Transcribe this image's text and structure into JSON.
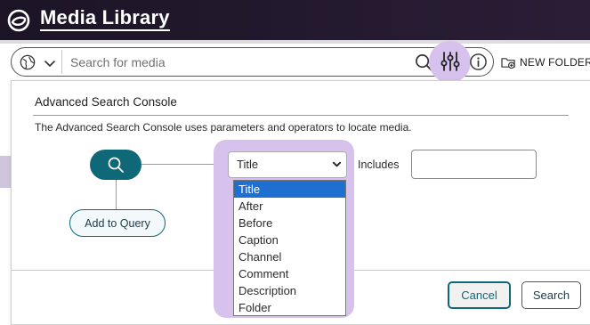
{
  "header": {
    "title": "Media Library"
  },
  "search": {
    "placeholder": "Search for media",
    "value": ""
  },
  "toolbar": {
    "new_folder_label": "NEW FOLDER"
  },
  "panel": {
    "title": "Advanced Search Console",
    "description": "The Advanced Search Console uses parameters and operators to locate media.",
    "add_to_query_label": "Add to Query",
    "operator_label": "Includes",
    "field_selected": "Title",
    "field_options": [
      "Title",
      "After",
      "Before",
      "Caption",
      "Channel",
      "Comment",
      "Description",
      "Folder"
    ],
    "value_input": "",
    "cancel_label": "Cancel",
    "search_label": "Search"
  },
  "colors": {
    "header_bg": "#1c1426",
    "accent_teal": "#0e6878",
    "highlight_lilac": "#d6c2ec",
    "selection_blue": "#1f6fd1"
  },
  "icons": [
    "logo-icon",
    "globe-icon",
    "chevron-down-icon",
    "search-icon",
    "filter-sliders-icon",
    "info-icon",
    "new-folder-icon"
  ]
}
